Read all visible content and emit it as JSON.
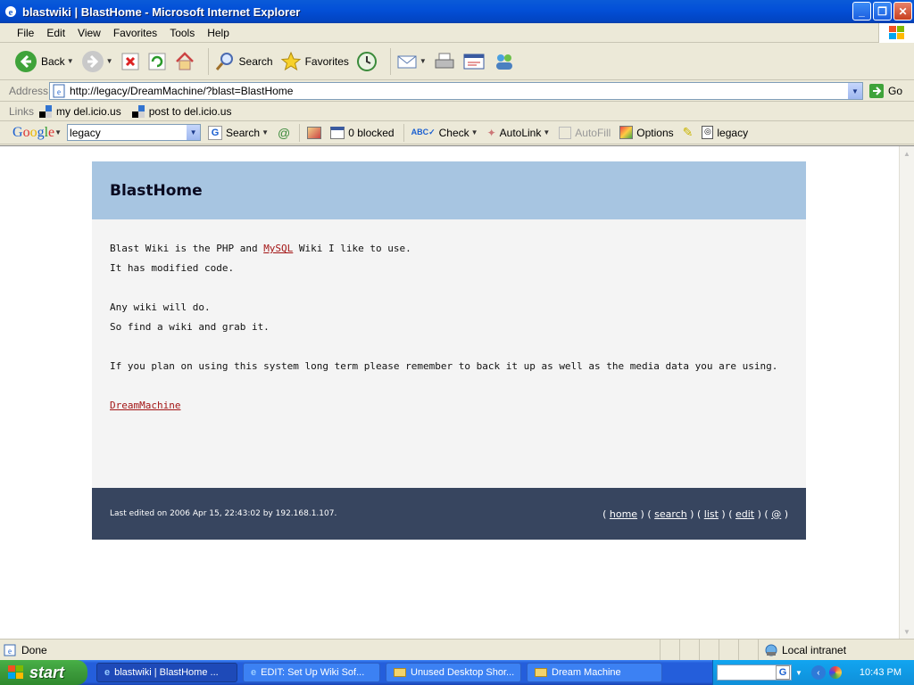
{
  "window": {
    "title": "blastwiki | BlastHome - Microsoft Internet Explorer"
  },
  "menu": [
    "File",
    "Edit",
    "View",
    "Favorites",
    "Tools",
    "Help"
  ],
  "toolbar": {
    "back": "Back",
    "search": "Search",
    "favorites": "Favorites"
  },
  "address": {
    "label": "Address",
    "url": "http://legacy/DreamMachine/?blast=BlastHome",
    "go": "Go"
  },
  "links": {
    "label": "Links",
    "items": [
      "my del.icio.us",
      "post to del.icio.us"
    ]
  },
  "google": {
    "logo": "Google",
    "query": "legacy",
    "search": "Search",
    "blocked": "0 blocked",
    "check": "Check",
    "autolink": "AutoLink",
    "autofill": "AutoFill",
    "options": "Options",
    "highlight": "legacy"
  },
  "wiki": {
    "title": "BlastHome",
    "line1_pre": "Blast Wiki is the PHP and ",
    "line1_link": "MySQL",
    "line1_post": " Wiki I like to use.",
    "line2": "It has modified code.",
    "line3": "Any wiki will do.",
    "line4": "So find a wiki and grab it.",
    "line5": "If you plan on using this system long term please remember to back it up as well as the media data you are using.",
    "link": "DreamMachine",
    "footer": "Last edited on 2006 Apr 15, 22:43:02 by 192.168.1.107.",
    "nav": [
      "home",
      "search",
      "list",
      "edit",
      "@"
    ]
  },
  "status": {
    "text": "Done",
    "zone": "Local intranet"
  },
  "taskbar": {
    "start": "start",
    "tasks": [
      "blastwiki | BlastHome ...",
      "EDIT: Set Up Wiki Sof...",
      "Unused Desktop Shor...",
      "Dream Machine"
    ],
    "clock": "10:43 PM"
  }
}
